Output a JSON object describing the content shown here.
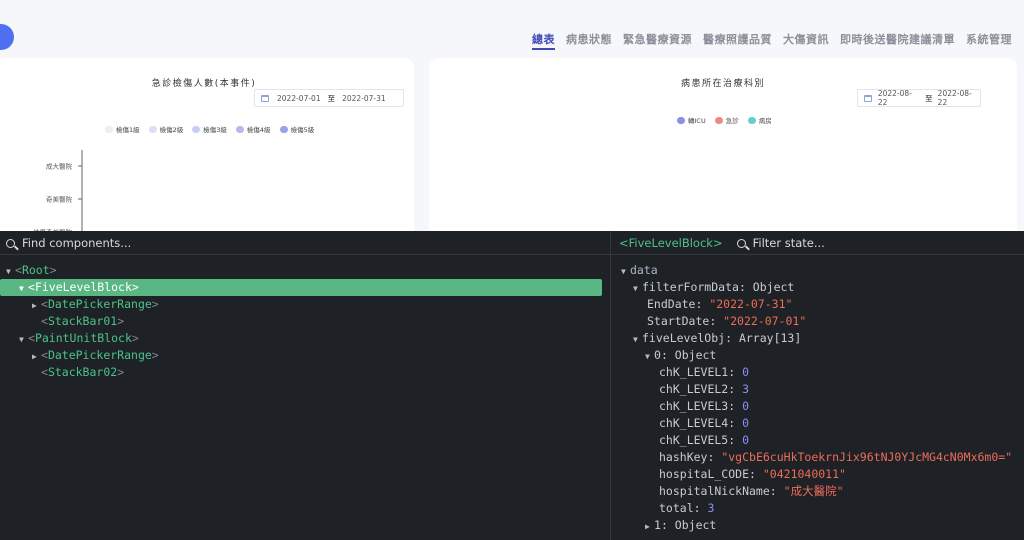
{
  "nav": {
    "items": [
      "總表",
      "病患狀態",
      "緊急醫療資源",
      "醫療照護品質",
      "大傷資訊",
      "即時後送醫院建議清單",
      "系統管理"
    ],
    "active_index": 0
  },
  "card_left": {
    "title": "急診檢傷人數(本事件)",
    "date_start": "2022-07-01",
    "date_sep": "至",
    "date_end": "2022-07-31",
    "legend": [
      {
        "label": "檢傷1級",
        "color": "#eceef6"
      },
      {
        "label": "檢傷2級",
        "color": "#dde0f4"
      },
      {
        "label": "檢傷3級",
        "color": "#c8cdf2"
      },
      {
        "label": "檢傷4級",
        "color": "#b2b9ee"
      },
      {
        "label": "檢傷5級",
        "color": "#98a2ea"
      }
    ],
    "y_labels": [
      "成大醫院",
      "奇美醫院",
      "佳里奇美醫院"
    ]
  },
  "card_right": {
    "title": "病患所在治療科別",
    "date_start": "2022-08-22",
    "date_sep": "至",
    "date_end": "2022-08-22",
    "legend": [
      {
        "label": "轉ICU",
        "color": "#8b8fe8"
      },
      {
        "label": "急診",
        "color": "#ee8a86"
      },
      {
        "label": "病房",
        "color": "#62d1cf"
      }
    ]
  },
  "devtools": {
    "left": {
      "search_placeholder": "Find components...",
      "tree": [
        {
          "name": "Root",
          "depth": 0,
          "arrow": "▼",
          "selected": false
        },
        {
          "name": "FiveLevelBlock",
          "depth": 1,
          "arrow": "▼",
          "selected": true
        },
        {
          "name": "DatePickerRange",
          "depth": 2,
          "arrow": "▶",
          "selected": false
        },
        {
          "name": "StackBar01",
          "depth": 2,
          "arrow": "",
          "selected": false
        },
        {
          "name": "PaintUnitBlock",
          "depth": 1,
          "arrow": "▼",
          "selected": false
        },
        {
          "name": "DatePickerRange",
          "depth": 2,
          "arrow": "▶",
          "selected": false
        },
        {
          "name": "StackBar02",
          "depth": 2,
          "arrow": "",
          "selected": false
        }
      ]
    },
    "right": {
      "component_title": "<FiveLevelBlock>",
      "search_placeholder": "Filter state...",
      "rows": [
        {
          "depth": 0,
          "arrow": "▼",
          "key": "data",
          "type": "section"
        },
        {
          "depth": 1,
          "arrow": "▼",
          "key": "filterFormData",
          "value": "Object",
          "type": "plain"
        },
        {
          "depth": 2,
          "arrow": "",
          "key": "EndDate",
          "value": "\"2022-07-31\"",
          "type": "string"
        },
        {
          "depth": 2,
          "arrow": "",
          "key": "StartDate",
          "value": "\"2022-07-01\"",
          "type": "string"
        },
        {
          "depth": 1,
          "arrow": "▼",
          "key": "fiveLevelObj",
          "value": "Array[13]",
          "type": "plain"
        },
        {
          "depth": 2,
          "arrow": "▼",
          "key": "0",
          "value": "Object",
          "type": "plain"
        },
        {
          "depth": 3,
          "arrow": "",
          "key": "chK_LEVEL1",
          "value": "0",
          "type": "number"
        },
        {
          "depth": 3,
          "arrow": "",
          "key": "chK_LEVEL2",
          "value": "3",
          "type": "number"
        },
        {
          "depth": 3,
          "arrow": "",
          "key": "chK_LEVEL3",
          "value": "0",
          "type": "number"
        },
        {
          "depth": 3,
          "arrow": "",
          "key": "chK_LEVEL4",
          "value": "0",
          "type": "number"
        },
        {
          "depth": 3,
          "arrow": "",
          "key": "chK_LEVEL5",
          "value": "0",
          "type": "number"
        },
        {
          "depth": 3,
          "arrow": "",
          "key": "hashKey",
          "value": "\"vgCbE6cuHkToekrnJix96tNJ0YJcMG4cN0Mx6m0=\"",
          "type": "string"
        },
        {
          "depth": 3,
          "arrow": "",
          "key": "hospitaL_CODE",
          "value": "\"0421040011\"",
          "type": "string"
        },
        {
          "depth": 3,
          "arrow": "",
          "key": "hospitalNickName",
          "value": "\"成大醫院\"",
          "type": "string"
        },
        {
          "depth": 3,
          "arrow": "",
          "key": "total",
          "value": "3",
          "type": "number"
        },
        {
          "depth": 2,
          "arrow": "▶",
          "key": "1",
          "value": "Object",
          "type": "plain"
        }
      ]
    }
  }
}
